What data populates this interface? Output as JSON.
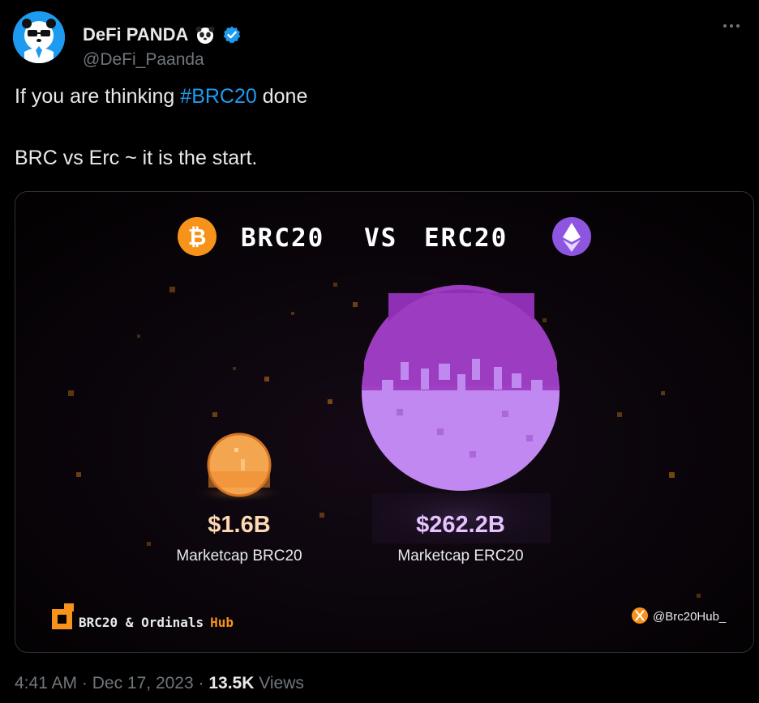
{
  "author": {
    "display_name": "DeFi PANDA",
    "handle": "@DeFi_Paanda",
    "verified": true,
    "badge_emoji": "panda-face"
  },
  "tweet": {
    "line1_prefix": "If you are thinking ",
    "hashtag": "#BRC20",
    "line1_suffix": " done",
    "line2": "BRC vs Erc ~ it is the start."
  },
  "media": {
    "title_left": "BRC20",
    "title_vs": "VS",
    "title_right": "ERC20",
    "brc_value": "$1.6B",
    "brc_label": "Marketcap BRC20",
    "erc_value": "$262.2B",
    "erc_label": "Marketcap ERC20",
    "brand_left": "BRC20 & Ordinals",
    "brand_hub": "Hub",
    "brand_handle": "@Brc20Hub_",
    "colors": {
      "bitcoin": "#f7931a",
      "ethereum": "#9b59e8",
      "brc_value": "#fcd9b0",
      "erc_value": "#e5c3ff",
      "hub": "#f7931a"
    }
  },
  "meta": {
    "time": "4:41 AM",
    "sep1": " · ",
    "date": "Dec 17, 2023",
    "sep2": " · ",
    "views_count": "13.5K",
    "views_label": " Views"
  }
}
